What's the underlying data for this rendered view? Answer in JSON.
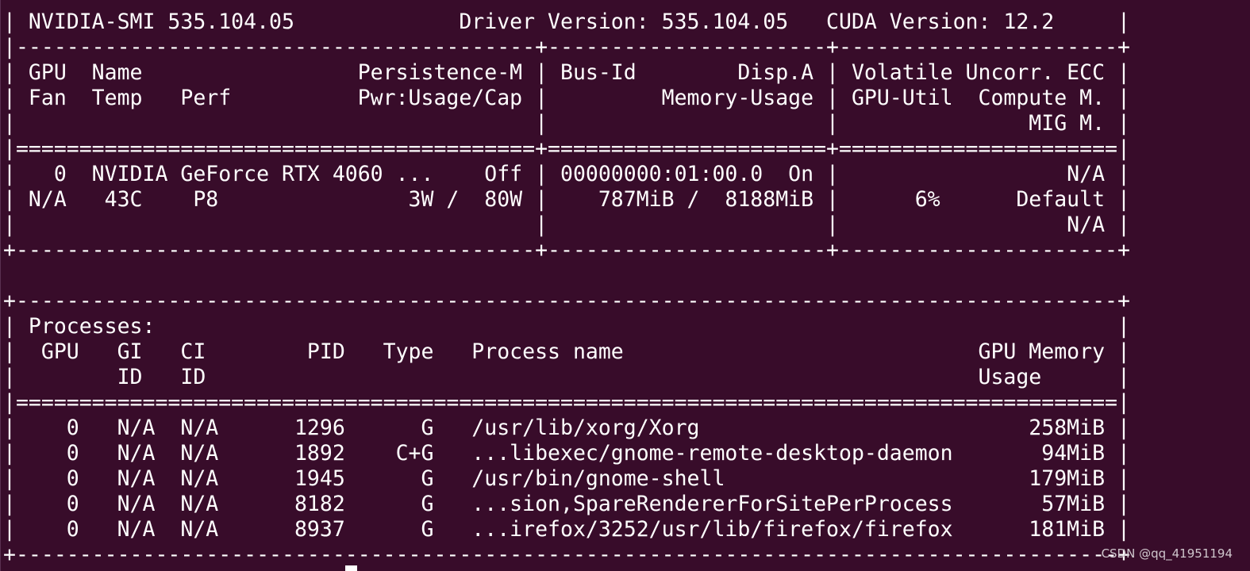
{
  "terminal": {
    "lines": [
      "| NVIDIA-SMI 535.104.05             Driver Version: 535.104.05   CUDA Version: 12.2     |",
      "|-----------------------------------------+----------------------+----------------------+",
      "| GPU  Name                 Persistence-M | Bus-Id        Disp.A | Volatile Uncorr. ECC |",
      "| Fan  Temp   Perf          Pwr:Usage/Cap |         Memory-Usage | GPU-Util  Compute M. |",
      "|                                         |                      |               MIG M. |",
      "|=========================================+======================+======================|",
      "|   0  NVIDIA GeForce RTX 4060 ...    Off | 00000000:01:00.0  On |                  N/A |",
      "| N/A   43C    P8               3W /  80W |    787MiB /  8188MiB |      6%      Default |",
      "|                                         |                      |                  N/A |",
      "+-----------------------------------------+----------------------+----------------------+",
      "",
      "+---------------------------------------------------------------------------------------+",
      "| Processes:                                                                            |",
      "|  GPU   GI   CI        PID   Type   Process name                            GPU Memory |",
      "|        ID   ID                                                             Usage      |",
      "|=======================================================================================|",
      "|    0   N/A  N/A      1296      G   /usr/lib/xorg/Xorg                          258MiB |",
      "|    0   N/A  N/A      1892    C+G   ...libexec/gnome-remote-desktop-daemon       94MiB |",
      "|    0   N/A  N/A      1945      G   /usr/bin/gnome-shell                        179MiB |",
      "|    0   N/A  N/A      8182      G   ...sion,SpareRendererForSitePerProcess       57MiB |",
      "|    0   N/A  N/A      8937      G   ...irefox/3252/usr/lib/firefox/firefox      181MiB |",
      "+---------------------------------------------------------------------------------------+"
    ]
  },
  "watermark": "CSDN @qq_41951194",
  "colors": {
    "background": "#380c2a",
    "foreground": "#ffffff"
  }
}
